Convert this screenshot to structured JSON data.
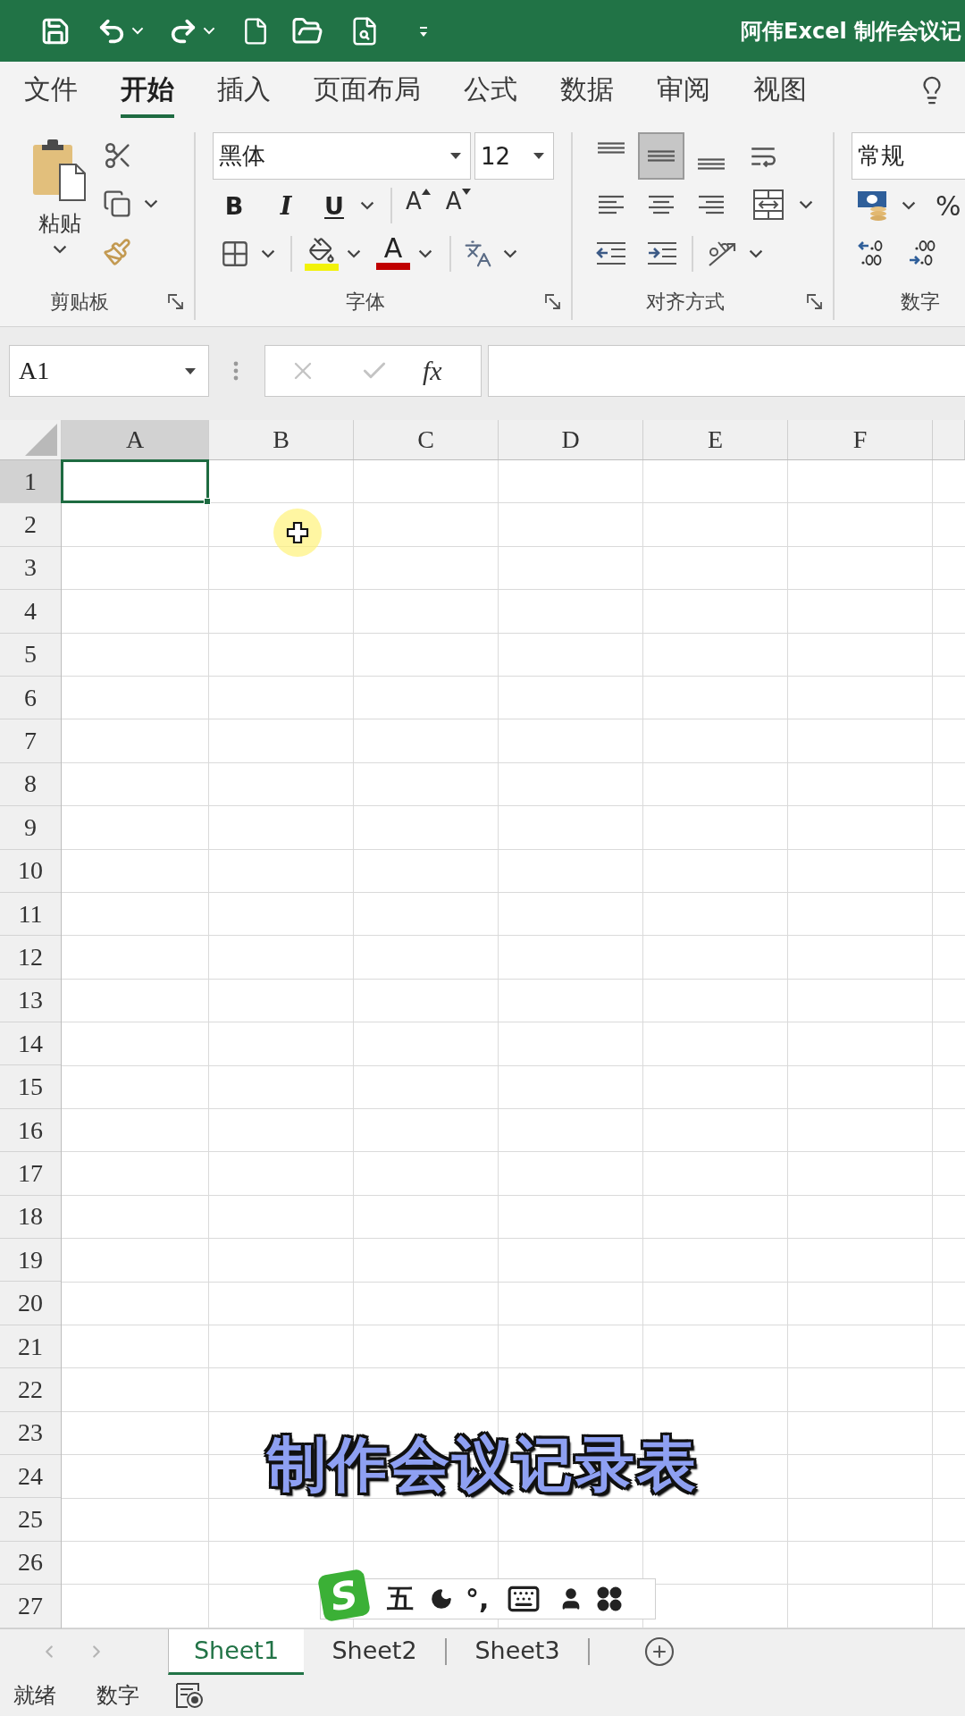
{
  "title_bar": {
    "title": "阿伟Excel 制作会议记"
  },
  "ribbon_tabs": [
    {
      "label": "文件",
      "selected": false
    },
    {
      "label": "开始",
      "selected": true
    },
    {
      "label": "插入",
      "selected": false
    },
    {
      "label": "页面布局",
      "selected": false
    },
    {
      "label": "公式",
      "selected": false
    },
    {
      "label": "数据",
      "selected": false
    },
    {
      "label": "审阅",
      "selected": false
    },
    {
      "label": "视图",
      "selected": false
    }
  ],
  "ribbon": {
    "clipboard": {
      "paste": "粘贴",
      "label": "剪贴板"
    },
    "font": {
      "font_name": "黑体",
      "font_size": "12",
      "style_buttons": [
        {
          "kind": "bold",
          "glyph": "B"
        },
        {
          "kind": "italic",
          "glyph": "I"
        },
        {
          "kind": "underline",
          "glyph": "U"
        }
      ],
      "size_buttons": [
        {
          "kind": "grow",
          "glyph": "A"
        },
        {
          "kind": "shrink",
          "glyph": "A"
        }
      ],
      "font_color": "A",
      "label": "字体"
    },
    "alignment": {
      "vertical": [
        {
          "kind": "top",
          "selected": false
        },
        {
          "kind": "middle",
          "selected": true
        },
        {
          "kind": "bottom",
          "selected": false
        }
      ],
      "horizontal": [
        {
          "kind": "left",
          "selected": false
        },
        {
          "kind": "center",
          "selected": false
        },
        {
          "kind": "right",
          "selected": false
        }
      ],
      "label": "对齐方式"
    },
    "number": {
      "format": "常规",
      "percent": "%",
      "label": "数字"
    }
  },
  "formula_bar": {
    "name_box": "A1",
    "function_button": "fx"
  },
  "sheet": {
    "columns": [
      {
        "label": "A",
        "selected": true
      },
      {
        "label": "B",
        "selected": false
      },
      {
        "label": "C",
        "selected": false
      },
      {
        "label": "D",
        "selected": false
      },
      {
        "label": "E",
        "selected": false
      },
      {
        "label": "F",
        "selected": false
      }
    ],
    "rows": [
      {
        "label": "1",
        "selected": true
      },
      {
        "label": "2",
        "selected": false
      },
      {
        "label": "3",
        "selected": false
      },
      {
        "label": "4",
        "selected": false
      },
      {
        "label": "5",
        "selected": false
      },
      {
        "label": "6",
        "selected": false
      },
      {
        "label": "7",
        "selected": false
      },
      {
        "label": "8",
        "selected": false
      },
      {
        "label": "9",
        "selected": false
      },
      {
        "label": "10",
        "selected": false
      },
      {
        "label": "11",
        "selected": false
      },
      {
        "label": "12",
        "selected": false
      },
      {
        "label": "13",
        "selected": false
      },
      {
        "label": "14",
        "selected": false
      },
      {
        "label": "15",
        "selected": false
      },
      {
        "label": "16",
        "selected": false
      },
      {
        "label": "17",
        "selected": false
      },
      {
        "label": "18",
        "selected": false
      },
      {
        "label": "19",
        "selected": false
      },
      {
        "label": "20",
        "selected": false
      },
      {
        "label": "21",
        "selected": false
      },
      {
        "label": "22",
        "selected": false
      },
      {
        "label": "23",
        "selected": false
      },
      {
        "label": "24",
        "selected": false
      },
      {
        "label": "25",
        "selected": false
      },
      {
        "label": "26",
        "selected": false
      },
      {
        "label": "27",
        "selected": false
      }
    ]
  },
  "caption": "制作会议记录表",
  "ime_toolbar": {
    "logo": "S",
    "mode": "五",
    "punctuation": "°,"
  },
  "sheet_tabs": [
    {
      "label": "Sheet1",
      "selected": true
    },
    {
      "label": "Sheet2",
      "selected": false
    },
    {
      "label": "Sheet3",
      "selected": false
    }
  ],
  "status_bar": {
    "items": [
      "就绪",
      "数字"
    ]
  }
}
